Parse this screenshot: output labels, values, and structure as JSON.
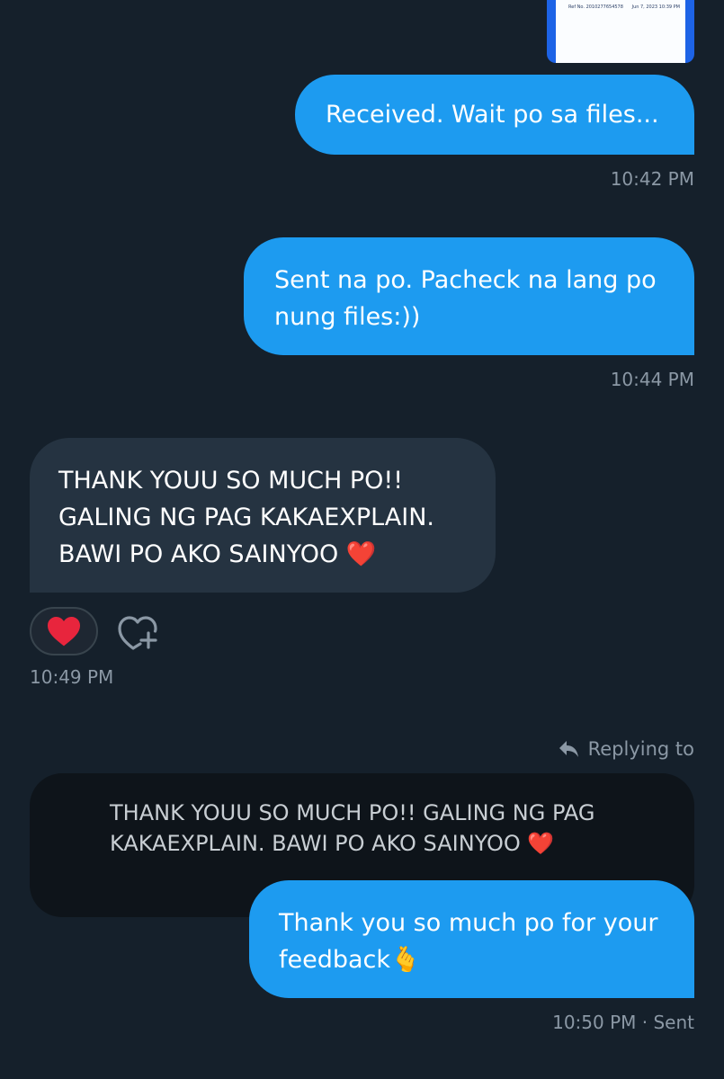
{
  "receipt": {
    "ref": "Ref No. 2010277654578",
    "date": "Jun 7, 2023 10:39 PM"
  },
  "messages": [
    {
      "direction": "sent",
      "lines": [
        "Received. Wait po sa files..."
      ],
      "time": "10:42 PM"
    },
    {
      "direction": "sent",
      "lines": [
        "Sent na po. Pacheck na lang po",
        "nung files:))"
      ],
      "time": "10:44 PM"
    },
    {
      "direction": "received",
      "lines": [
        "THANK YOUU SO MUCH PO!!",
        "GALING NG PAG KAKAEXPLAIN.",
        "BAWI PO AKO SAINYOO ❤️"
      ],
      "reaction": "❤️",
      "time": "10:49 PM"
    },
    {
      "direction": "sent",
      "lines": [
        "Thank you so much po for your",
        "feedback🫰"
      ],
      "time": "10:50 PM · Sent"
    }
  ],
  "reply": {
    "label": "Replying to",
    "quote_lines": [
      "THANK YOUU SO MUCH PO!! GALING NG PAG",
      "KAKAEXPLAIN. BAWI PO AKO SAINYOO ❤️"
    ]
  },
  "icons": {
    "reply": "reply-arrow-icon",
    "add_reaction": "heart-plus-icon",
    "reaction": "red-heart-icon"
  },
  "colors": {
    "background": "#15202b",
    "sent_bubble": "#1d9bf0",
    "received_bubble": "#253341",
    "timestamp": "#8b98a5"
  }
}
